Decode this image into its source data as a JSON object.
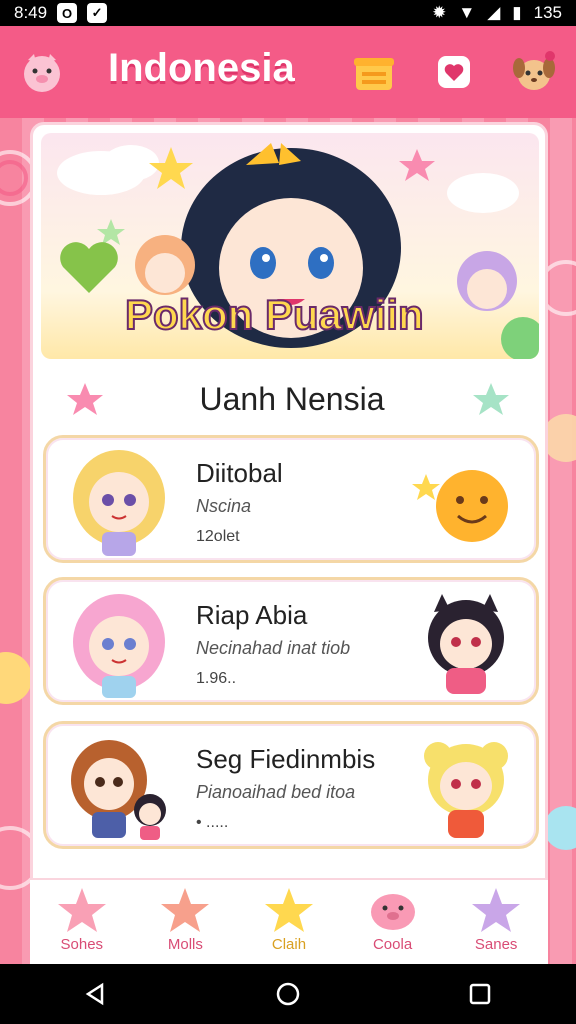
{
  "status_bar": {
    "time": "8:49",
    "battery": "135"
  },
  "header": {
    "title": "Indonesia",
    "icons": [
      "pig-face-icon",
      "gift-box-icon",
      "heart-badge-icon",
      "puppy-face-icon"
    ]
  },
  "banner": {
    "title": "Pokon Puawiin"
  },
  "section": {
    "title": "Uanh Nensia"
  },
  "items": [
    {
      "title": "Diitobal",
      "subtitle": "Nscina",
      "meta": "12olet"
    },
    {
      "title": "Riap Abia",
      "subtitle": "Necinahad inat tiob",
      "meta": "1.96.."
    },
    {
      "title": "Seg Fiedinmbis",
      "subtitle": "Pianoaihad bed itoa",
      "meta": "• ....."
    }
  ],
  "bottom_nav": [
    {
      "label": "Sohes",
      "icon": "star-icon",
      "color": "#f9a0b5"
    },
    {
      "label": "Molls",
      "icon": "star-icon",
      "color": "#f7a08c"
    },
    {
      "label": "Claih",
      "icon": "star-icon",
      "color": "#ffd84f"
    },
    {
      "label": "Coola",
      "icon": "pig-icon",
      "color": "#f99ab5"
    },
    {
      "label": "Sanes",
      "icon": "star-icon",
      "color": "#c9a6e8"
    }
  ],
  "colors": {
    "header": "#f45b87",
    "accent": "#ffd84f"
  }
}
